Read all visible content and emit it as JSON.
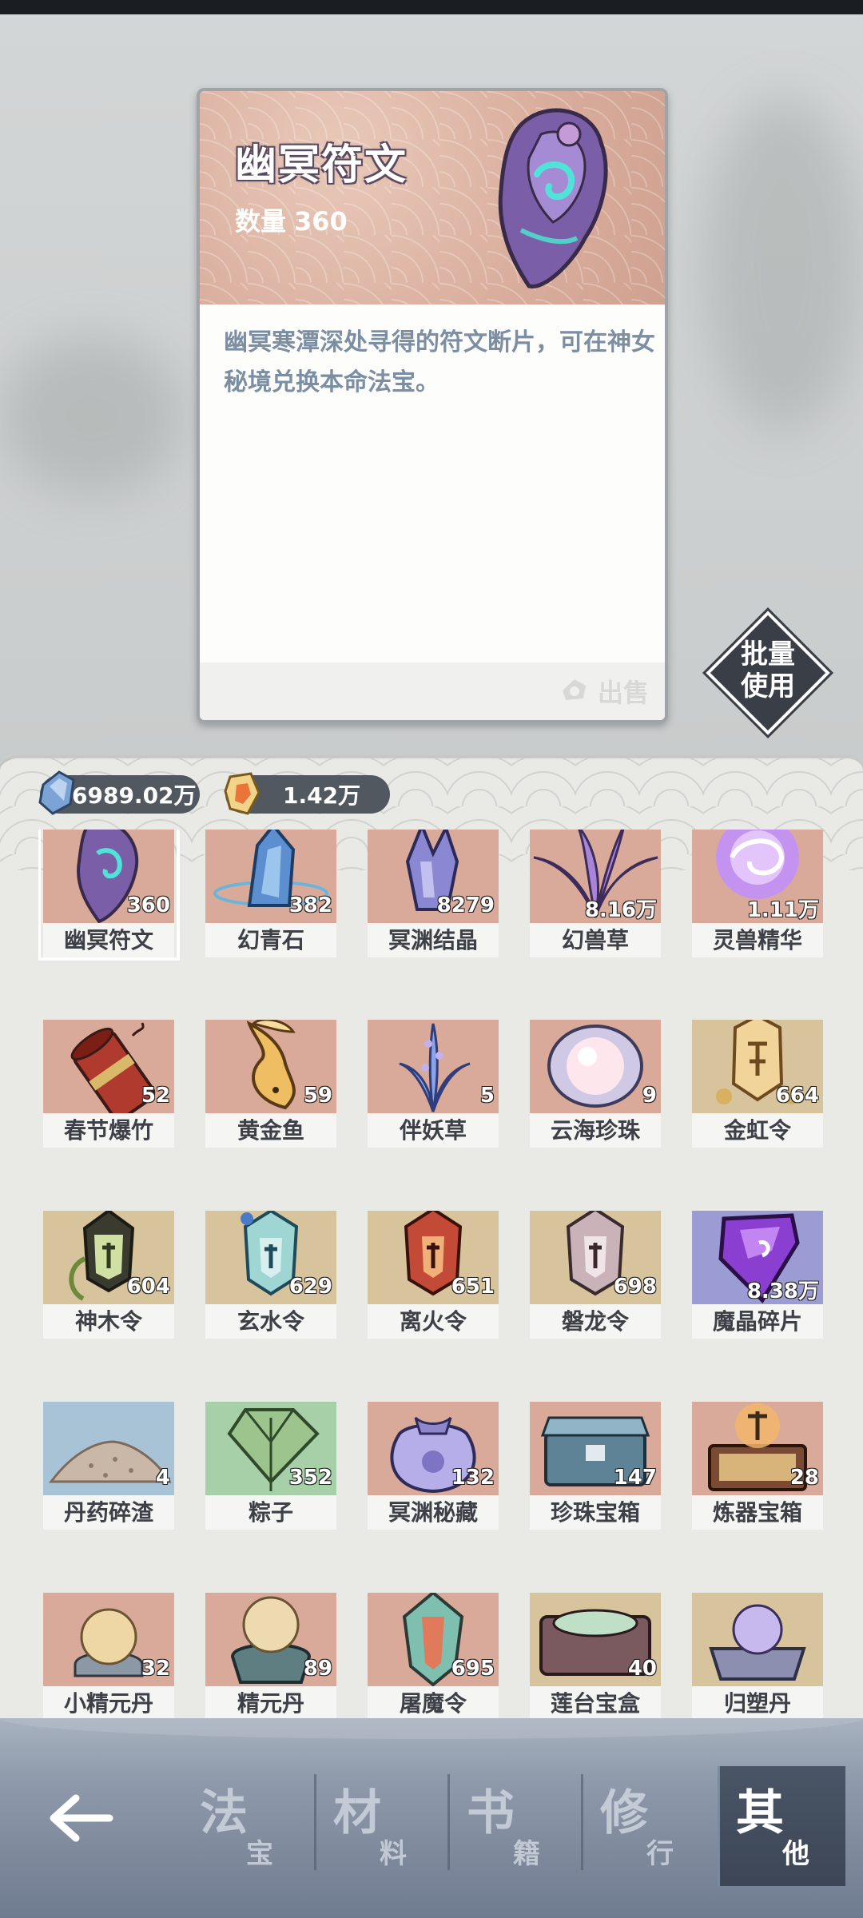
{
  "detail": {
    "title": "幽冥符文",
    "qty_label": "数量",
    "qty_value": "360",
    "description": "幽冥寒潭深处寻得的符文断片，可在神女秘境兑换本命法宝。",
    "sell_label": "出售"
  },
  "batch_use": {
    "line1": "批量",
    "line2": "使用"
  },
  "currencies": [
    {
      "icon": "blue-crystal-icon",
      "value": "6989.02万"
    },
    {
      "icon": "gold-token-icon",
      "value": "1.42万"
    }
  ],
  "items": [
    {
      "name": "幽冥符文",
      "count": "360",
      "bg": "#d9aa9a",
      "icon": "purple-rune-icon",
      "selected": true
    },
    {
      "name": "幻青石",
      "count": "382",
      "bg": "#d9aa9a",
      "icon": "blue-crystal-icon"
    },
    {
      "name": "冥渊结晶",
      "count": "8279",
      "bg": "#d9aa9a",
      "icon": "violet-crystal-icon"
    },
    {
      "name": "幻兽草",
      "count": "8.16万",
      "bg": "#d9aa9a",
      "icon": "purple-grass-icon"
    },
    {
      "name": "灵兽精华",
      "count": "1.11万",
      "bg": "#d9aa9a",
      "icon": "purple-orb-icon"
    },
    {
      "name": "春节爆竹",
      "count": "52",
      "bg": "#d9aa9a",
      "icon": "firecracker-icon"
    },
    {
      "name": "黄金鱼",
      "count": "59",
      "bg": "#d9aa9a",
      "icon": "golden-fish-icon"
    },
    {
      "name": "伴妖草",
      "count": "5",
      "bg": "#d9aa9a",
      "icon": "lavender-plant-icon"
    },
    {
      "name": "云海珍珠",
      "count": "9",
      "bg": "#d9aa9a",
      "icon": "pearl-icon"
    },
    {
      "name": "金虹令",
      "count": "664",
      "bg": "#d8c49c",
      "icon": "gold-token-icon"
    },
    {
      "name": "神木令",
      "count": "604",
      "bg": "#d8c49c",
      "icon": "wood-token-icon"
    },
    {
      "name": "玄水令",
      "count": "629",
      "bg": "#d8c49c",
      "icon": "water-token-icon"
    },
    {
      "name": "离火令",
      "count": "651",
      "bg": "#d8c49c",
      "icon": "fire-token-icon"
    },
    {
      "name": "磐龙令",
      "count": "698",
      "bg": "#d8c49c",
      "icon": "dragon-token-icon"
    },
    {
      "name": "魔晶碎片",
      "count": "8.38万",
      "bg": "#9c9cd4",
      "icon": "purple-shard-icon"
    },
    {
      "name": "丹药碎渣",
      "count": "4",
      "bg": "#a9c3d6",
      "icon": "powder-pile-icon"
    },
    {
      "name": "粽子",
      "count": "352",
      "bg": "#a8d0a8",
      "icon": "zongzi-icon"
    },
    {
      "name": "冥渊秘藏",
      "count": "132",
      "bg": "#d9aa9a",
      "icon": "treasure-bag-icon"
    },
    {
      "name": "珍珠宝箱",
      "count": "147",
      "bg": "#d9aa9a",
      "icon": "pearl-chest-icon"
    },
    {
      "name": "炼器宝箱",
      "count": "28",
      "bg": "#d9aa9a",
      "icon": "forge-chest-icon"
    },
    {
      "name": "小精元丹",
      "count": "32",
      "bg": "#d9aa9a",
      "icon": "small-pill-icon"
    },
    {
      "name": "精元丹",
      "count": "89",
      "bg": "#d9aa9a",
      "icon": "pill-icon"
    },
    {
      "name": "屠魔令",
      "count": "695",
      "bg": "#d9aa9a",
      "icon": "demon-slayer-token-icon"
    },
    {
      "name": "莲台宝盒",
      "count": "40",
      "bg": "#d8c49c",
      "icon": "lotus-box-icon"
    },
    {
      "name": "归塑丹",
      "count": "",
      "bg": "#d8c49c",
      "icon": "orb-altar-icon"
    }
  ],
  "nav": {
    "back_icon": "back-arrow-icon",
    "tabs": [
      {
        "big": "法",
        "small": "宝",
        "active": false
      },
      {
        "big": "材",
        "small": "料",
        "active": false
      },
      {
        "big": "书",
        "small": "籍",
        "active": false
      },
      {
        "big": "修",
        "small": "行",
        "active": false
      },
      {
        "big": "其",
        "small": "他",
        "active": true
      }
    ]
  }
}
